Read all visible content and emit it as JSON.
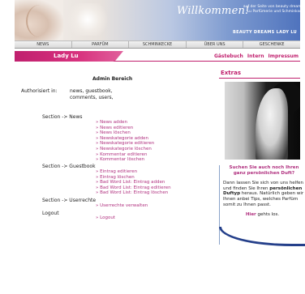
{
  "header": {
    "welcome": "Willkommen!",
    "tagline": "auf der Seite von beauty dreams Lady Lu Parfümerie und Schminkschule",
    "brand": "BEAUTY DREAMS LADY LU"
  },
  "nav": [
    "NEWS",
    "PARFÜM",
    "SCHMINKECKE",
    "ÜBER UNS",
    "GESCHENKE"
  ],
  "userbar": {
    "user": "Lady Lu",
    "links": [
      "Gästebuch",
      "Intern",
      "Impressum"
    ]
  },
  "main": {
    "title": "Admin Bereich",
    "auth_label": "Authorisiert in:",
    "auth_value": "news, guestbook, comments, users,",
    "news_label": "Section -> News",
    "news_links": [
      "News adden",
      "News editieren",
      "News löschen",
      "Newskategorie adden",
      "Newskategorie editieren",
      "Newskategorie löschen",
      "Kommentar editieren",
      "Kommentar löschen"
    ],
    "guestbook_label": "Section -> Guestbook",
    "guestbook_links": [
      "Eintrag editieren",
      "Eintrag löschen",
      "Bad Word List: Eintrag adden",
      "Bad Word List: Eintrag editieren",
      "Bad Word List: Eintrag löschen"
    ],
    "userrights_label": "Section -> Userrechte",
    "userrights_links": [
      "Userrechte verwalten"
    ],
    "logout_label": "Logout",
    "logout_links": [
      "Logout"
    ]
  },
  "sidebar": {
    "title": "Extras",
    "headline": "Suchen Sie auch noch Ihren ganz persönlichen Duft?",
    "body_1": "Dann lassen Sie sich von uns helfen und finden Sie Ihren",
    "body_bold": "persönlichen Duftyp",
    "body_2": "heraus. Natürlich geben wir Ihnen anbei Tips, welches Parfüm somit zu Ihnen passt.",
    "here_link": "Hier",
    "here_rest": "gehts los."
  }
}
